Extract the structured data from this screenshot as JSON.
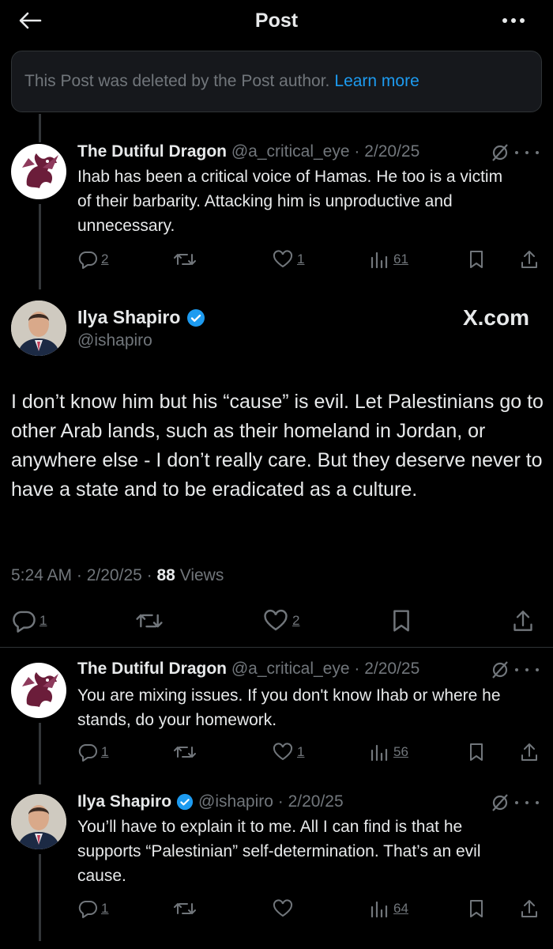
{
  "header": {
    "title": "Post",
    "back_icon": "arrow-left-icon",
    "more_icon": "more-horizontal-icon"
  },
  "deleted_notice": {
    "text": "This Post was deleted by the Post author.",
    "link": "Learn more"
  },
  "replies": [
    {
      "name": "The Dutiful Dragon",
      "handle": "@a_critical_eye",
      "date": "2/20/25",
      "text": "Ihab has been a critical voice of Hamas. He too is a victim of their barbarity. Attacking him is unproductive and unnecessary.",
      "replies": "2",
      "reposts": "",
      "likes": "1",
      "views": "61"
    },
    {
      "name": "The Dutiful Dragon",
      "handle": "@a_critical_eye",
      "date": "2/20/25",
      "text": "You are mixing issues. If you don't know Ihab or where he stands, do your homework.",
      "replies": "1",
      "reposts": "",
      "likes": "1",
      "views": "56"
    },
    {
      "name": "Ilya Shapiro",
      "handle": "@ishapiro",
      "date": "2/20/25",
      "text": "You’ll have to explain it to me. All I can find is that he supports “Palestinian” self-determination. That’s an evil cause.",
      "replies": "1",
      "reposts": "",
      "likes": "",
      "views": "64"
    }
  ],
  "main_post": {
    "name": "Ilya Shapiro",
    "handle": "@ishapiro",
    "watermark": "X.com",
    "text": "I don’t know him but his “cause” is evil. Let Palestinians go to other Arab lands, such as their homeland in Jordan, or anywhere else - I don’t really care. But they deserve never to have a state and to be eradicated as a culture.",
    "time": "5:24 AM",
    "date": "2/20/25",
    "views_count": "88",
    "views_label": "Views",
    "replies": "1",
    "likes": "2"
  },
  "colors": {
    "accent": "#1d9bf0",
    "muted": "#71767b",
    "text": "#e7e9ea",
    "background": "#000000"
  }
}
